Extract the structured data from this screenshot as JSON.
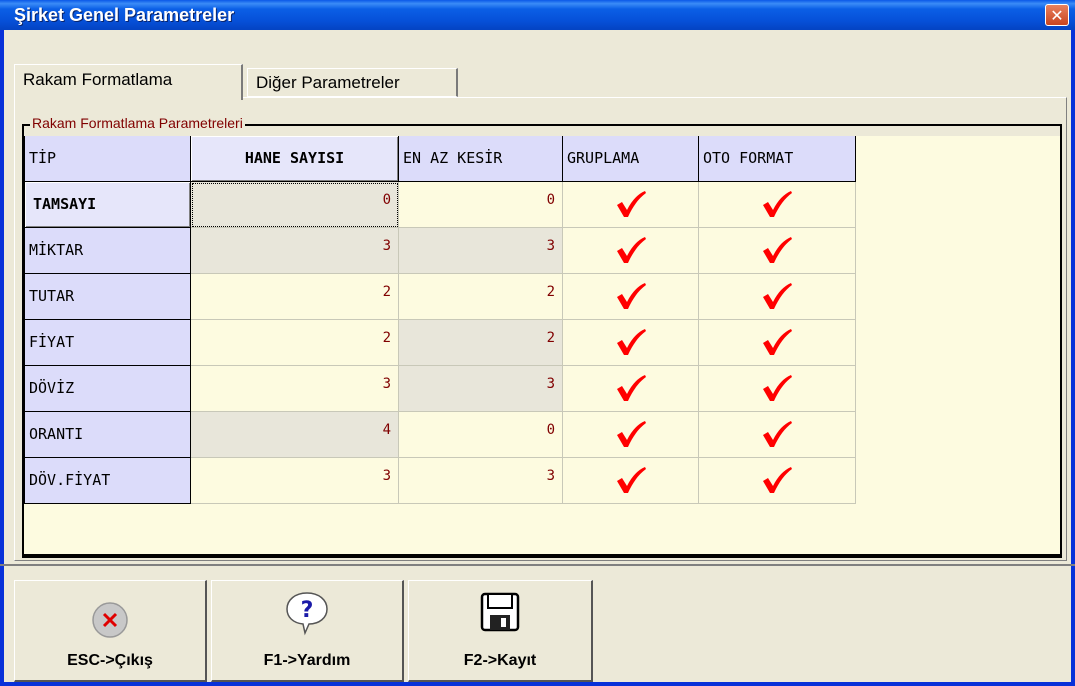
{
  "window": {
    "title": "Şirket Genel Parametreler",
    "close_symbol": "✕"
  },
  "tabs": [
    {
      "label": "Rakam Formatlama",
      "active": true
    },
    {
      "label": "Diğer Parametreler",
      "active": false
    }
  ],
  "group": {
    "label": "Rakam Formatlama Parametreleri"
  },
  "grid": {
    "columns": [
      "TİP",
      "HANE SAYISI",
      "EN AZ KESİR",
      "GRUPLAMA",
      "OTO FORMAT"
    ],
    "rows": [
      {
        "tip": "TAMSAYI",
        "hane": "0",
        "kesir": "0",
        "gruplama": true,
        "oto": true
      },
      {
        "tip": "MİKTAR",
        "hane": "3",
        "kesir": "3",
        "gruplama": true,
        "oto": true
      },
      {
        "tip": "TUTAR",
        "hane": "2",
        "kesir": "2",
        "gruplama": true,
        "oto": true
      },
      {
        "tip": "FİYAT",
        "hane": "2",
        "kesir": "2",
        "gruplama": true,
        "oto": true
      },
      {
        "tip": "DÖVİZ",
        "hane": "3",
        "kesir": "3",
        "gruplama": true,
        "oto": true
      },
      {
        "tip": "ORANTI",
        "hane": "4",
        "kesir": "0",
        "gruplama": true,
        "oto": true
      },
      {
        "tip": "DÖV.FİYAT",
        "hane": "3",
        "kesir": "3",
        "gruplama": true,
        "oto": true
      }
    ],
    "selected_row": "TAMSAYI",
    "selected_column": "HANE SAYISI"
  },
  "buttons": {
    "exit": "ESC->Çıkış",
    "help": "F1->Yardım",
    "save": "F2->Kayıt"
  },
  "colors": {
    "title_bar": "#0650d8",
    "check": "#ff0000",
    "grid_bg": "#fdfbe0",
    "header_bg": "#dcdcfa"
  }
}
